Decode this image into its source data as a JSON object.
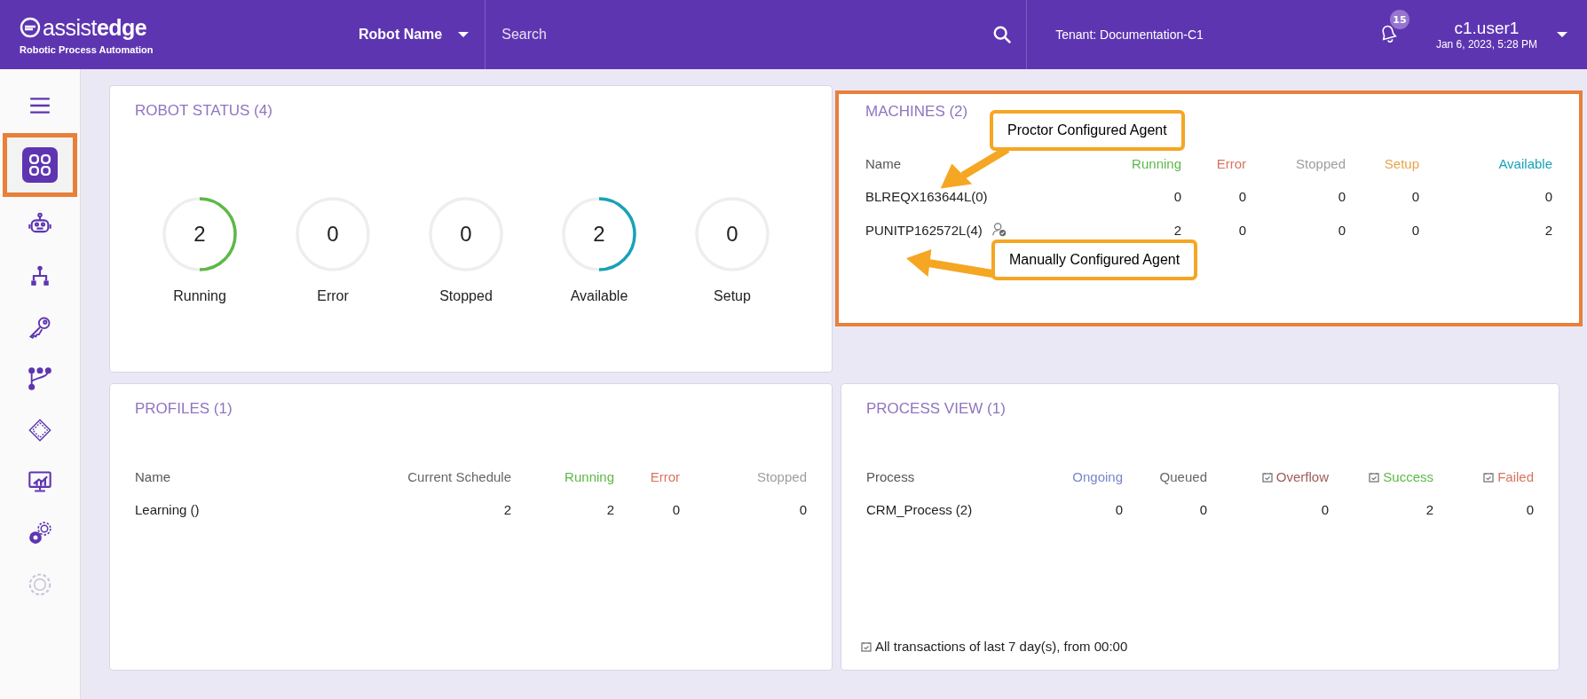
{
  "header": {
    "logo": "assist**edge**",
    "tagline": "Robotic Process Automation",
    "robot_select": "Robot Name",
    "search": {
      "placeholder": "Search"
    },
    "tenant": "Tenant: Documentation-C1",
    "notifications": "15",
    "user": "c1.user1",
    "datetime": "Jan 6, 2023, 5:28 PM"
  },
  "sidebar": [
    {
      "kind": "menu",
      "selected": false,
      "disabled": false,
      "highlighted": false
    },
    {
      "kind": "dashboard",
      "selected": true,
      "disabled": false,
      "highlighted": true
    },
    {
      "kind": "robot",
      "selected": false,
      "disabled": false,
      "highlighted": false
    },
    {
      "kind": "hierarchy",
      "selected": false,
      "disabled": false,
      "highlighted": false
    },
    {
      "kind": "key",
      "selected": false,
      "disabled": false,
      "highlighted": false
    },
    {
      "kind": "flow",
      "selected": false,
      "disabled": false,
      "highlighted": false
    },
    {
      "kind": "chip",
      "selected": false,
      "disabled": false,
      "highlighted": false
    },
    {
      "kind": "monitor",
      "selected": false,
      "disabled": false,
      "highlighted": false
    },
    {
      "kind": "gears",
      "selected": false,
      "disabled": false,
      "highlighted": false
    },
    {
      "kind": "gear",
      "selected": false,
      "disabled": true,
      "highlighted": false
    }
  ],
  "robot_status": {
    "title": "ROBOT STATUS (4)",
    "items": [
      {
        "value": "2",
        "label": "Running",
        "level": 0.5,
        "color": "#5cb946"
      },
      {
        "value": "0",
        "label": "Error"
      },
      {
        "value": "0",
        "label": "Stopped"
      },
      {
        "value": "2",
        "label": "Available",
        "level": 0.5,
        "color": "#17a2b8"
      },
      {
        "value": "0",
        "label": "Setup"
      }
    ]
  },
  "machines": {
    "title": "MACHINES (2)",
    "highlighted": true,
    "columns": [
      {
        "label": "Name",
        "color": "#555555"
      },
      {
        "label": "Running",
        "color": "#5cb946"
      },
      {
        "label": "Error",
        "color": "#d9735f"
      },
      {
        "label": "Stopped",
        "color": "#9e9e9e"
      },
      {
        "label": "Setup",
        "color": "#e8a54b"
      },
      {
        "label": "Available",
        "color": "#17a2b8"
      }
    ],
    "rows": [
      {
        "user_icon": false,
        "cells": [
          "BLREQX163644L(0)",
          "0",
          "0",
          "0",
          "0",
          "0"
        ]
      },
      {
        "user_icon": true,
        "cells": [
          "PUNITP162572L(4)",
          "2",
          "0",
          "0",
          "0",
          "2"
        ]
      }
    ],
    "callouts": [
      "Proctor Configured Agent",
      "Manually Configured Agent"
    ]
  },
  "profiles": {
    "title": "PROFILES (1)",
    "columns": [
      {
        "label": "Name",
        "color": "#555555"
      },
      {
        "label": "Current Schedule",
        "color": "#666666"
      },
      {
        "label": "Running",
        "color": "#5cb946"
      },
      {
        "label": "Error",
        "color": "#d9735f"
      },
      {
        "label": "Stopped",
        "color": "#9e9e9e"
      }
    ],
    "rows": [
      {
        "cells": [
          "Learning ()",
          "2",
          "2",
          "0",
          "0"
        ]
      }
    ]
  },
  "process_view": {
    "title": "PROCESS VIEW (1)",
    "columns": [
      {
        "label": "Process",
        "color": "#555555",
        "kind": "plain"
      },
      {
        "label": "Ongoing",
        "color": "#7986cb",
        "kind": "plain"
      },
      {
        "label": "Queued",
        "color": "#666666",
        "kind": "plain"
      },
      {
        "label": "Overflow",
        "color": "#a05a5a",
        "kind": "dated"
      },
      {
        "label": "Success",
        "color": "#5cb946",
        "kind": "dated"
      },
      {
        "label": "Failed",
        "color": "#d9735f",
        "kind": "dated"
      }
    ],
    "rows": [
      {
        "cells": [
          "CRM_Process (2)",
          "0",
          "0",
          "0",
          "2",
          "0"
        ]
      }
    ],
    "footnote": "All transactions of last 7 day(s), from 00:00"
  }
}
